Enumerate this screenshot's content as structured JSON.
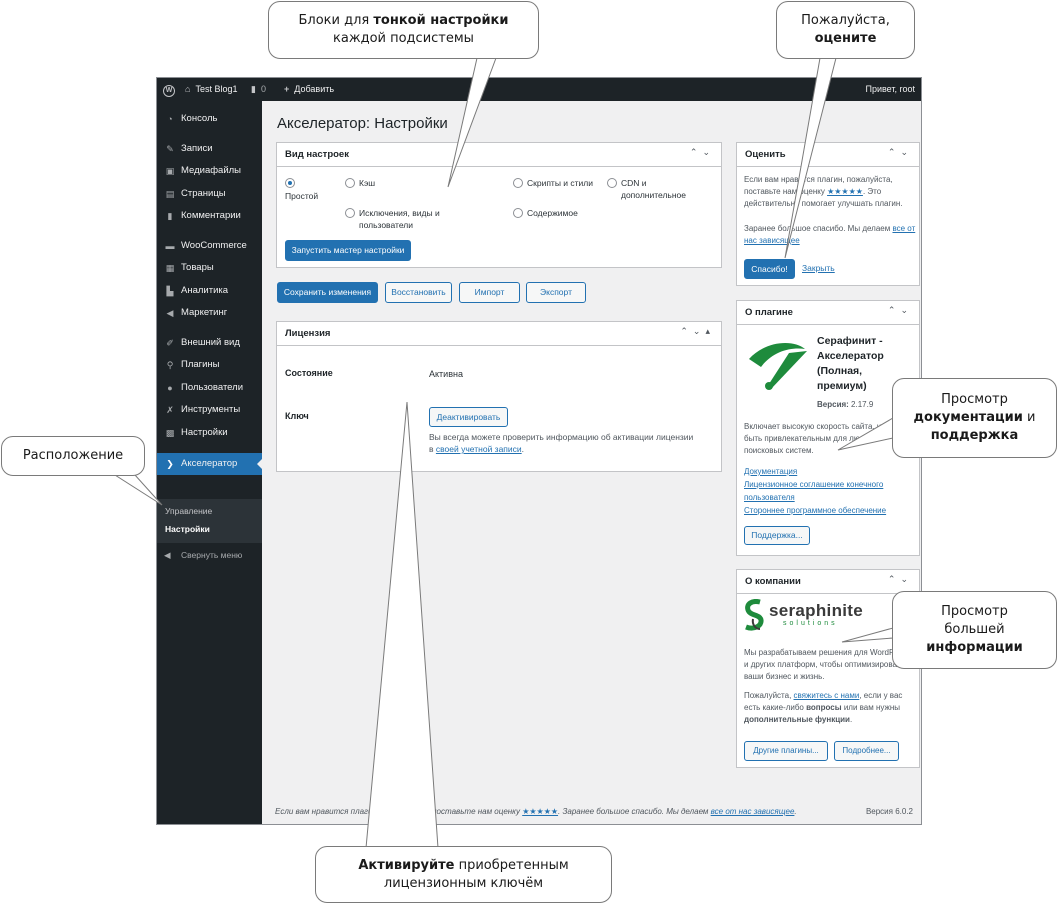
{
  "adminbar": {
    "site_name": "Test Blog1",
    "comments_count": "0",
    "new_label": "Добавить",
    "howdy": "Привет, root"
  },
  "sidebar": {
    "items": [
      {
        "label": "Консоль",
        "icon": "dashboard-icon"
      },
      {
        "label": "Записи",
        "icon": "pin-icon"
      },
      {
        "label": "Медиафайлы",
        "icon": "media-icon"
      },
      {
        "label": "Страницы",
        "icon": "page-icon"
      },
      {
        "label": "Комментарии",
        "icon": "comment-icon"
      },
      {
        "label": "WooCommerce",
        "icon": "woocommerce-icon"
      },
      {
        "label": "Товары",
        "icon": "archive-icon"
      },
      {
        "label": "Аналитика",
        "icon": "chart-icon"
      },
      {
        "label": "Маркетинг",
        "icon": "megaphone-icon"
      },
      {
        "label": "Внешний вид",
        "icon": "brush-icon"
      },
      {
        "label": "Плагины",
        "icon": "plugin-icon"
      },
      {
        "label": "Пользователи",
        "icon": "user-icon"
      },
      {
        "label": "Инструменты",
        "icon": "wrench-icon"
      },
      {
        "label": "Настройки",
        "icon": "settings-icon"
      },
      {
        "label": "Акселератор",
        "icon": "accelerator-icon"
      }
    ],
    "submenu": [
      "Управление",
      "Настройки"
    ],
    "collapse_label": "Свернуть меню"
  },
  "page": {
    "title": "Акселератор: Настройки"
  },
  "settings_box": {
    "title": "Вид настроек",
    "options": [
      {
        "label": "Простой",
        "checked": true
      },
      {
        "label": "Кэш",
        "checked": false
      },
      {
        "label": "Скрипты и стили",
        "checked": false
      },
      {
        "label": "CDN и дополнительное",
        "checked": false
      },
      {
        "label": "Исключения, виды и пользователи",
        "checked": false
      },
      {
        "label": "Содержимое",
        "checked": false
      }
    ],
    "wizard_button": "Запустить мастер настройки"
  },
  "actions": {
    "save": "Сохранить изменения",
    "restore": "Восстановить",
    "import": "Импорт",
    "export": "Экспорт"
  },
  "license_box": {
    "title": "Лицензия",
    "state_label": "Состояние",
    "state_value": "Активна",
    "key_label": "Ключ",
    "deactivate": "Деактивировать",
    "note_before": "Вы всегда можете проверить информацию об активации лицензии в ",
    "note_link": "своей учетной записи",
    "note_after": "."
  },
  "rate_box": {
    "title": "Оценить",
    "text1": "Если вам нравится плагин, пожалуйста, поставьте нам оценку",
    "stars": "★★★★★",
    "text2": ". Это действительно помогает улучшать плагин.",
    "text3": "Заранее большое спасибо. Мы делаем",
    "text3_link": "все от нас зависящее",
    "thanks_button": "Спасибо!",
    "close_link": "Закрыть"
  },
  "about_plugin": {
    "title": "О плагине",
    "name": "Серафинит - Акселератор (Полная, премиум)",
    "version_label": "Версия:",
    "version": "2.17.9",
    "description": "Включает высокую скорость сайта, чтобы быть привлекательным для людей и поисковых систем.",
    "links": [
      "Документация",
      "Лицензионное соглашение конечного пользователя",
      "Стороннее программное обеспечение"
    ],
    "support_button": "Поддержка..."
  },
  "about_company": {
    "title": "О компании",
    "logo_main": "seraphinite",
    "logo_sub": "solutions",
    "text1": "Мы разрабатываем решения для WordPress и других платформ, чтобы оптимизировать ваши бизнес и жизнь.",
    "contact_before": "Пожалуйста, ",
    "contact_link": "свяжитесь с нами",
    "contact_mid": ", если у вас есть какие-либо ",
    "contact_bold1": "вопросы",
    "contact_mid2": " или вам нужны ",
    "contact_bold2": "дополнительные функции",
    "contact_end": ".",
    "other_plugins": "Другие плагины...",
    "more": "Подробнее..."
  },
  "footer": {
    "text_before": "Если вам нравится плагин, пожалуйста, поставьте нам оценку ",
    "stars": "★★★★★",
    "text_mid": ". Заранее большое спасибо. Мы делаем ",
    "link": "все от нас зависящее",
    "text_end": ".",
    "version": "Версия 6.0.2"
  },
  "callouts": {
    "blocks": {
      "line1_plain": "Блоки для ",
      "line1_bold": "тонкой настройки",
      "line2": "каждой подсистемы"
    },
    "rate": {
      "line1": "Пожалуйста,",
      "line2_bold": "оцените"
    },
    "location": {
      "text": "Расположение"
    },
    "docs": {
      "line1": "Просмотр",
      "line2_bold": "документации",
      "line2_plain": " и",
      "line3_bold": "поддержка"
    },
    "info": {
      "line1": "Просмотр",
      "line2": "большей",
      "line3_bold": "информации"
    },
    "activate": {
      "line1_bold": "Активируйте",
      "line1_plain": " приобретенным",
      "line2": "лицензионным ключём"
    }
  },
  "colors": {
    "accent": "#2271b1",
    "admin_dark": "#1d2327",
    "logo_green": "#1e8b3c"
  }
}
